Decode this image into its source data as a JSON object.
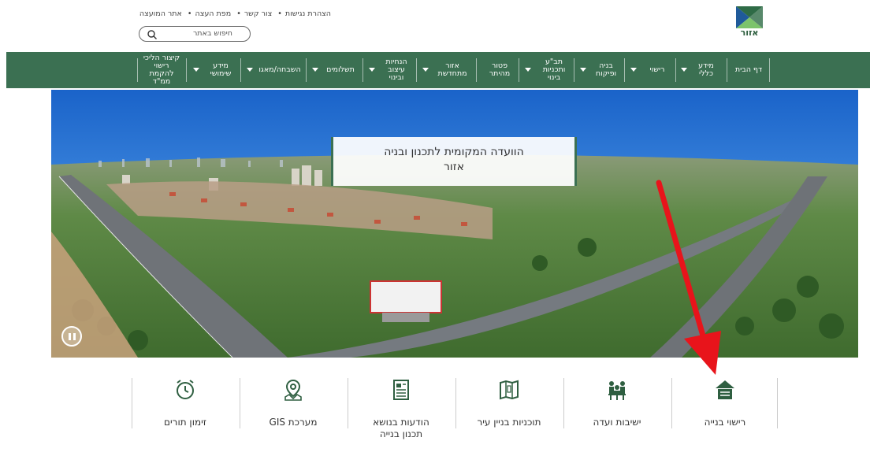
{
  "header": {
    "logo_text": "אזור",
    "top_links": [
      "הצהרת נגישות",
      "צור קשר",
      "מפת העצה",
      "אתר המועצה"
    ],
    "search_placeholder": "חיפוש באתר"
  },
  "nav": {
    "items": [
      {
        "label": "דף הבית",
        "caret": false
      },
      {
        "label": "מידע כללי",
        "caret": true
      },
      {
        "label": "רישוי",
        "caret": true
      },
      {
        "label": "בניה ופיקוח",
        "caret": true
      },
      {
        "label": "תב\"ע ותכניות בינוי",
        "caret": true
      },
      {
        "label": "פטור מהיתר",
        "caret": false
      },
      {
        "label": "אזור מתחדשת",
        "caret": true
      },
      {
        "label": "הנחיות עיצוב ובינוי",
        "caret": true
      },
      {
        "label": "תשלומים",
        "caret": true
      },
      {
        "label": "השבחה/מאגו",
        "caret": true
      },
      {
        "label": "מידע שימושי",
        "caret": true
      },
      {
        "label": "קיצור הליכי רישוי להקמת ממ\"ד",
        "caret": false
      }
    ]
  },
  "hero": {
    "title_line1": "הוועדה המקומית לתכנון ובניה",
    "title_line2": "אזור"
  },
  "services": [
    {
      "label": "רישוי בנייה",
      "icon": "house-icon"
    },
    {
      "label": "ישיבות ועדה",
      "icon": "meeting-icon"
    },
    {
      "label": "תוכניות בניין עיר",
      "icon": "map-book-icon"
    },
    {
      "label": "הודעות בנושא תכנון בנייה",
      "icon": "notice-icon"
    },
    {
      "label": "מערכת GIS",
      "icon": "map-pin-icon"
    },
    {
      "label": "זימון תורים",
      "icon": "alarm-clock-icon"
    }
  ],
  "colors": {
    "brand_green": "#3b7052",
    "arrow_red": "#e8141b"
  }
}
